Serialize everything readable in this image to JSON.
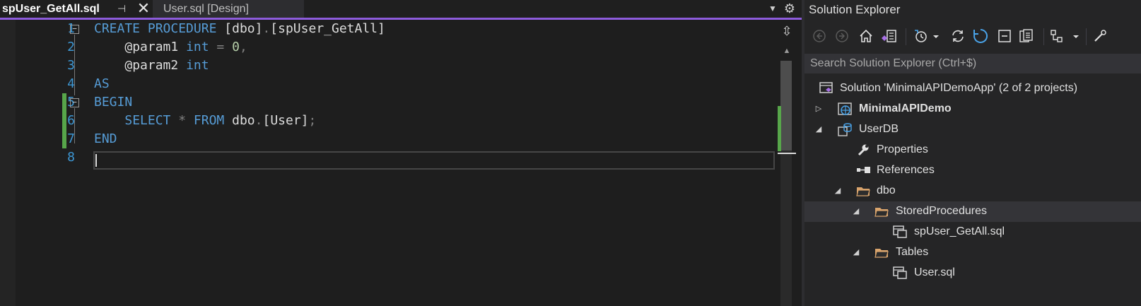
{
  "editor": {
    "tabs": [
      {
        "title": "spUser_GetAll.sql",
        "active": true
      },
      {
        "title": "User.sql [Design]",
        "active": false
      }
    ],
    "pin_icon": "pin-icon",
    "close_icon": "close-icon",
    "line_numbers": [
      "1",
      "2",
      "3",
      "4",
      "5",
      "6",
      "7",
      "8"
    ],
    "code": {
      "line1": {
        "kw1": "CREATE",
        "kw2": "PROCEDURE",
        "t1": "[dbo]",
        "p1": ".",
        "t2": "[spUser_GetAll]"
      },
      "line2": {
        "ident": "@param1",
        "type": "int",
        "op": "=",
        "num": "0",
        "comma": ","
      },
      "line3": {
        "ident": "@param2",
        "type": "int"
      },
      "line4": {
        "kw": "AS"
      },
      "line5": {
        "kw": "BEGIN"
      },
      "line6": {
        "kw1": "SELECT",
        "star": "*",
        "kw2": "FROM",
        "schema": "dbo",
        "dot": ".",
        "table": "[User]",
        "semi": ";"
      },
      "line7": {
        "kw": "END"
      },
      "line8": {}
    },
    "colors": {
      "keyword": "#569cd6",
      "number": "#b5cea8",
      "line_number": "#3d97d4",
      "change": "#57a64a",
      "accent": "#8d5bdc"
    }
  },
  "solution_explorer": {
    "title": "Solution Explorer",
    "search_placeholder": "Search Solution Explorer (Ctrl+$)",
    "toolbar_icons": [
      "back-icon",
      "forward-icon",
      "home-icon",
      "switch-views-icon",
      "pending-changes-icon",
      "sync-icon",
      "refresh-icon",
      "collapse-all-icon",
      "show-all-files-icon",
      "preview-icon",
      "properties-icon"
    ],
    "tree": [
      {
        "label": "Solution 'MinimalAPIDemoApp' (2 of 2 projects)",
        "icon": "solution-icon"
      },
      {
        "label": "MinimalAPIDemo",
        "icon": "web-project-icon",
        "bold": true,
        "expanded": false
      },
      {
        "label": "UserDB",
        "icon": "database-project-icon",
        "expanded": true
      },
      {
        "label": "Properties",
        "icon": "wrench-icon"
      },
      {
        "label": "References",
        "icon": "references-icon"
      },
      {
        "label": "dbo",
        "icon": "folder-icon",
        "expanded": true
      },
      {
        "label": "StoredProcedures",
        "icon": "folder-icon",
        "expanded": true
      },
      {
        "label": "spUser_GetAll.sql",
        "icon": "sql-file-icon"
      },
      {
        "label": "Tables",
        "icon": "folder-icon",
        "expanded": true
      },
      {
        "label": "User.sql",
        "icon": "sql-file-icon"
      }
    ]
  }
}
